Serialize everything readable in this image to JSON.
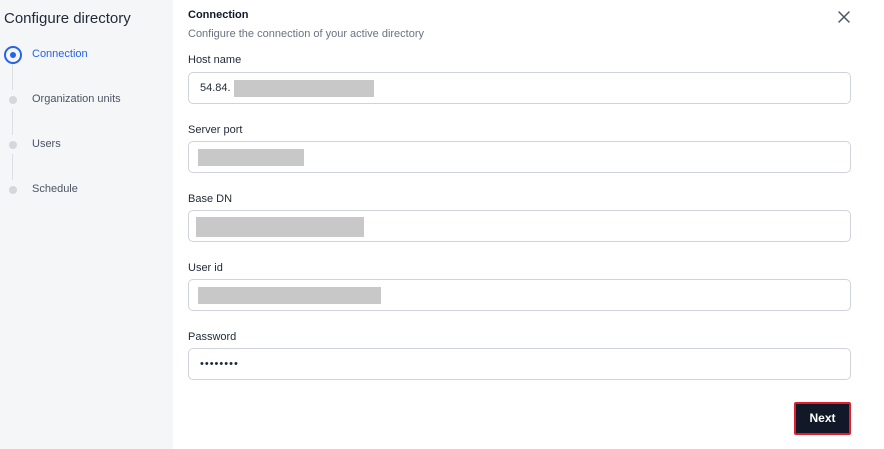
{
  "sidebar": {
    "title": "Configure directory",
    "steps": [
      {
        "label": "Connection",
        "state": "active"
      },
      {
        "label": "Organization units",
        "state": "pending"
      },
      {
        "label": "Users",
        "state": "pending"
      },
      {
        "label": "Schedule",
        "state": "pending"
      }
    ]
  },
  "panel": {
    "title": "Connection",
    "subtitle": "Configure the connection of your active directory",
    "close_icon": "close-icon"
  },
  "form": {
    "host_name": {
      "label": "Host name",
      "value": "54.84."
    },
    "server_port": {
      "label": "Server port",
      "value": ""
    },
    "base_dn": {
      "label": "Base DN",
      "value": ""
    },
    "user_id": {
      "label": "User id",
      "value": ""
    },
    "password": {
      "label": "Password",
      "value": "••••••••"
    }
  },
  "actions": {
    "next_label": "Next"
  },
  "colors": {
    "accent": "#2563eb",
    "button_bg": "#111827",
    "highlight_border": "#e11d2e"
  }
}
